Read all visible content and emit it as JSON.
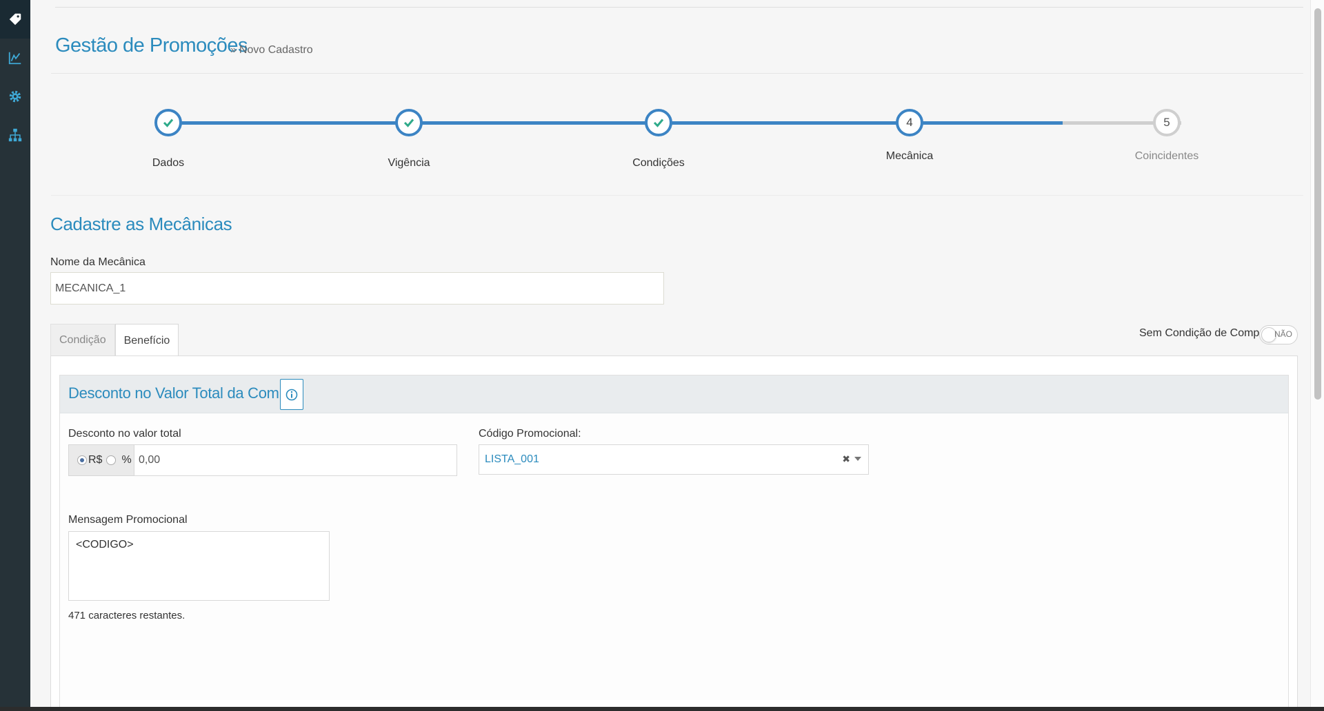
{
  "sidebar": {
    "items": [
      {
        "icon": "tag-icon",
        "active": true
      },
      {
        "icon": "line-chart-icon",
        "active": false
      },
      {
        "icon": "gear-icon",
        "active": false
      },
      {
        "icon": "org-chart-icon",
        "active": false
      }
    ],
    "background": "#263238",
    "icon_color": "#3fa9d6"
  },
  "header": {
    "title": "Gestão de Promoções",
    "breadcrumb_sep": "»",
    "breadcrumb_current": "Novo Cadastro"
  },
  "stepper": {
    "steps": [
      {
        "label": "Dados",
        "status": "done"
      },
      {
        "label": "Vigência",
        "status": "done"
      },
      {
        "label": "Condições",
        "status": "done"
      },
      {
        "label": "Mecânica",
        "status": "current",
        "number": "4"
      },
      {
        "label": "Coincidentes",
        "status": "pending",
        "number": "5"
      }
    ],
    "active_color": "#3c84c4",
    "check_color": "#2eaa8a",
    "pending_color": "#cfcfcf"
  },
  "form": {
    "section_title": "Cadastre as Mecânicas",
    "name_label": "Nome da Mecânica",
    "name_value": "MECANICA_1",
    "tabs": [
      {
        "label": "Condição",
        "active": false
      },
      {
        "label": "Benefício",
        "active": true
      }
    ],
    "toggle_label": "Sem Condição de Compra",
    "toggle_value": "NÃO",
    "panel_title": "Desconto no Valor Total da Compra",
    "discount_label": "Desconto no valor total",
    "currency_option": "R$",
    "percent_option": "%",
    "discount_value": "0,00",
    "promo_code_label": "Código Promocional:",
    "promo_code_value": "LISTA_001",
    "clear_symbol": "✖",
    "message_label": "Mensagem Promocional",
    "message_value": "<CODIGO>",
    "chars_remaining": "471 caracteres restantes."
  }
}
